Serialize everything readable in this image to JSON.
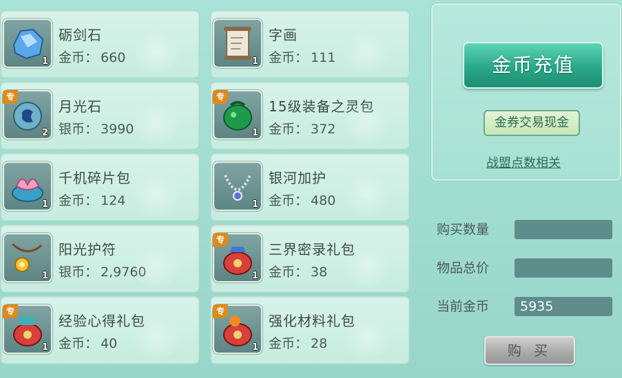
{
  "items": [
    {
      "name": "砺剑石",
      "currency": "金币：",
      "price": "660",
      "qty": "1",
      "special": "",
      "icon": "blue-crystal-icon"
    },
    {
      "name": "字画",
      "currency": "金币：",
      "price": "111",
      "qty": "1",
      "special": "",
      "icon": "scroll-icon"
    },
    {
      "name": "月光石",
      "currency": "银币：",
      "price": "3990",
      "qty": "2",
      "special": "专",
      "icon": "moonstone-icon"
    },
    {
      "name": "15级装备之灵包",
      "currency": "金币：",
      "price": "372",
      "qty": "1",
      "special": "专",
      "icon": "green-bag-icon"
    },
    {
      "name": "千机碎片包",
      "currency": "金币：",
      "price": "124",
      "qty": "1",
      "special": "",
      "icon": "lotus-bag-icon"
    },
    {
      "name": "银河加护",
      "currency": "金币：",
      "price": "480",
      "qty": "1",
      "special": "",
      "icon": "necklace-icon"
    },
    {
      "name": "阳光护符",
      "currency": "银币：",
      "price": "2,9760",
      "qty": "1",
      "special": "",
      "icon": "sun-amulet-icon"
    },
    {
      "name": "三界密录礼包",
      "currency": "金币：",
      "price": "38",
      "qty": "1",
      "special": "专",
      "icon": "red-gift-bag-icon"
    },
    {
      "name": "经验心得礼包",
      "currency": "金币：",
      "price": "40",
      "qty": "1",
      "special": "专",
      "icon": "red-gift-bag-icon"
    },
    {
      "name": "强化材料礼包",
      "currency": "金币：",
      "price": "28",
      "qty": "1",
      "special": "专",
      "icon": "red-gift-bag-icon"
    }
  ],
  "panel": {
    "recharge_label": "金币充值",
    "exchange_label": "金券交易现金",
    "alliance_label": "战盟点数相关"
  },
  "form": {
    "qty_label": "购买数量",
    "qty_value": "",
    "total_label": "物品总价",
    "total_value": "",
    "gold_label": "当前金币",
    "gold_value": "5935"
  },
  "buy_label": "购 买"
}
